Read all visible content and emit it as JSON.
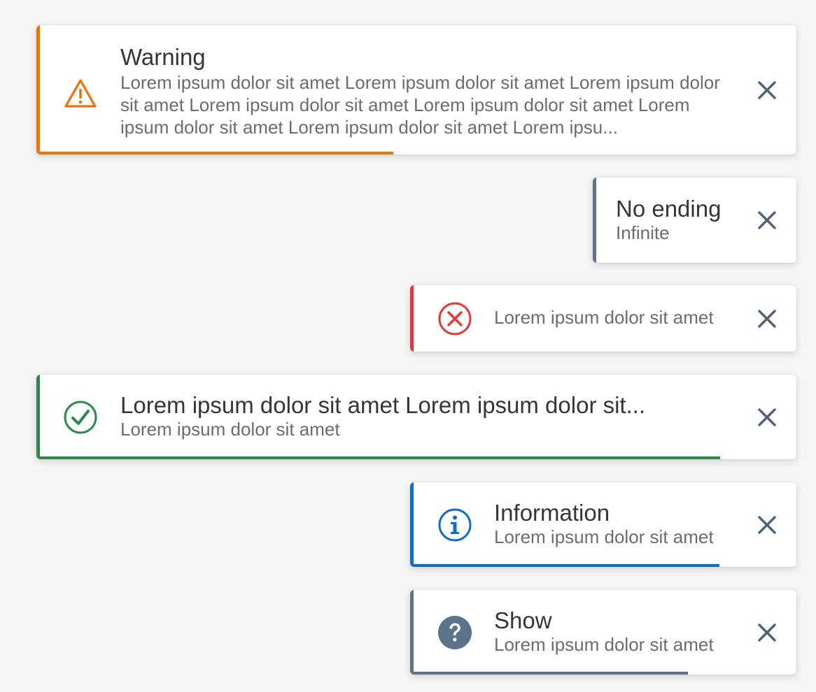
{
  "toasts": [
    {
      "type": "warning",
      "title": "Warning",
      "message": "Lorem ipsum dolor sit amet Lorem ipsum dolor sit amet Lorem ipsum dolor sit amet Lorem ipsum dolor sit amet Lorem ipsum dolor sit amet Lorem ipsum dolor sit amet Lorem ipsum dolor sit amet Lorem ipsu...",
      "color": "#e9730c",
      "progress": 0.47,
      "icon": "warning-icon"
    },
    {
      "type": "neutral",
      "title": "No ending",
      "message": "Infinite",
      "color": "#5b738b",
      "icon": "none"
    },
    {
      "type": "error",
      "title": "",
      "message": "Lorem ipsum dolor sit amet",
      "color": "#e83535",
      "icon": "error-icon"
    },
    {
      "type": "success",
      "title": "Lorem ipsum dolor sit amet Lorem ipsum dolor sit...",
      "message": "Lorem ipsum dolor sit amet",
      "color": "#2b8a4b",
      "progress": 0.9,
      "icon": "success-check-icon"
    },
    {
      "type": "information",
      "title": "Information",
      "message": "Lorem ipsum dolor sit amet",
      "color": "#0a6ed1",
      "progress": 0.8,
      "icon": "info-icon"
    },
    {
      "type": "question",
      "title": "Show",
      "message": "Lorem ipsum dolor sit amet",
      "color": "#5b738b",
      "progress": 0.72,
      "icon": "question-icon"
    }
  ],
  "close_icon": "close-icon",
  "close_color": "#4f6179"
}
